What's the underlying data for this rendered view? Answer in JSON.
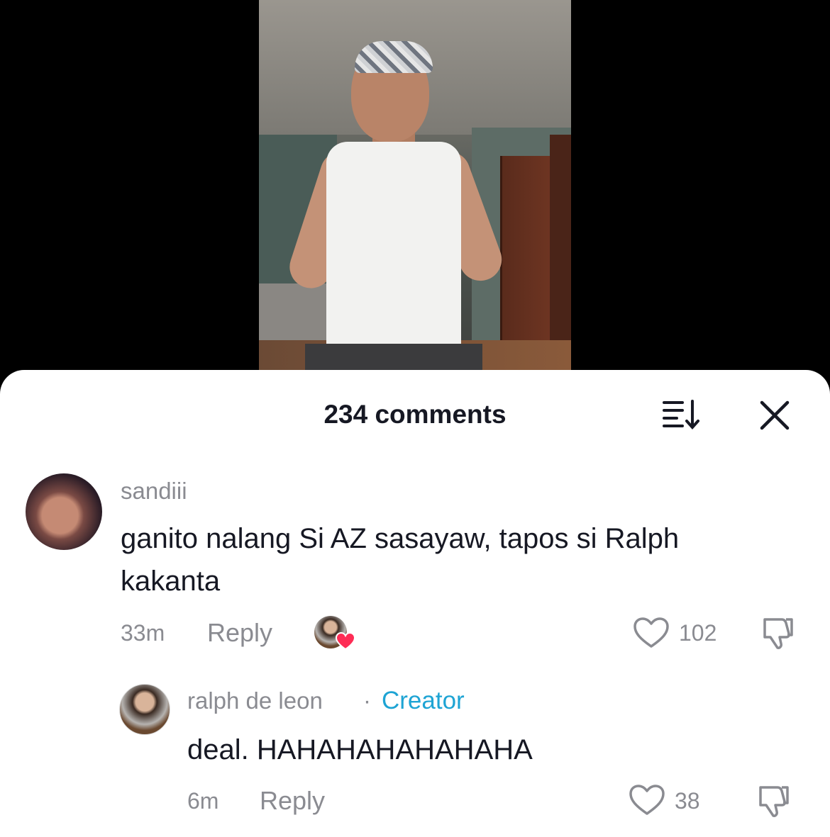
{
  "header": {
    "comment_count_label": "234 comments"
  },
  "icons": {
    "sort": "sort-icon",
    "close": "close-icon",
    "like": "heart-outline-icon",
    "dislike": "thumbs-down-icon",
    "creator_liked": "heart-badge-icon"
  },
  "colors": {
    "creator_accent": "#1ea4d4",
    "heart_badge": "#fe2c55",
    "text_primary": "#161823",
    "text_secondary": "#8a8b91"
  },
  "comments": [
    {
      "username": "sandiii",
      "text_line1": "ganito nalang Si AZ sasayaw, tapos si Ralph",
      "text_line2": "kakanta",
      "time": "33m",
      "reply_label": "Reply",
      "likes": "102"
    },
    {
      "username": "ralph de leon",
      "separator": "·",
      "badge": "Creator",
      "text": "deal. HAHAHAHAHAHAHA",
      "time": "6m",
      "reply_label": "Reply",
      "likes": "38"
    }
  ]
}
